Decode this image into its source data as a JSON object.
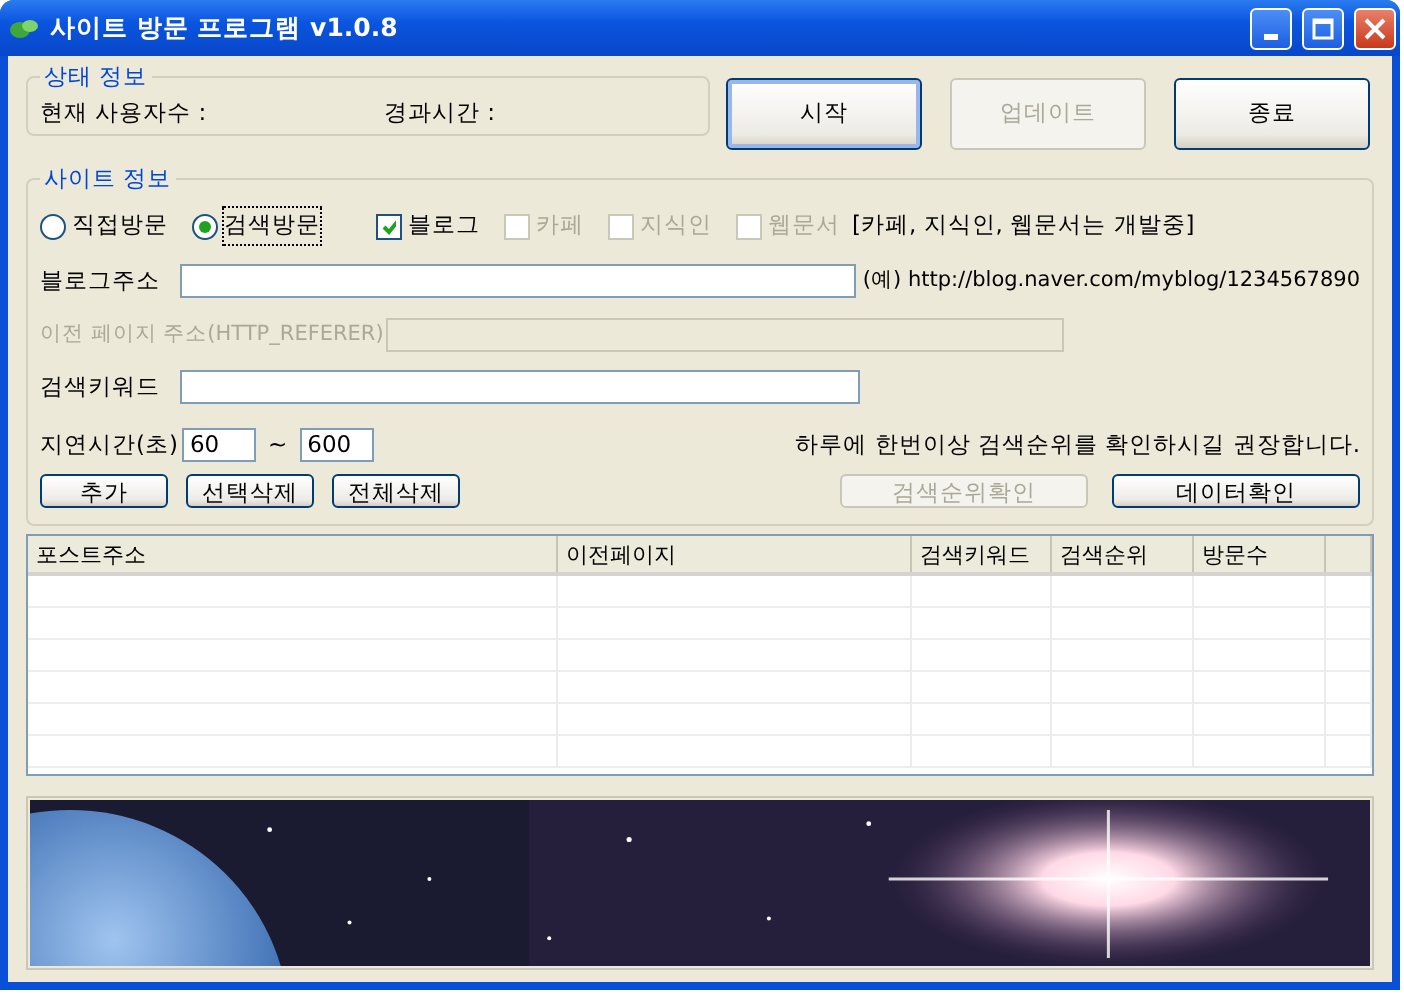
{
  "window": {
    "title": "사이트 방문 프로그램 v1.0.8"
  },
  "status_group": {
    "title": "상태 정보",
    "labels": [
      "현재 사용자수 :",
      "경과시간 :"
    ]
  },
  "top_buttons": [
    {
      "label": "시작",
      "disabled": false,
      "focused": true
    },
    {
      "label": "업데이트",
      "disabled": true,
      "focused": false
    },
    {
      "label": "종료",
      "disabled": false,
      "focused": false
    }
  ],
  "site_group": {
    "title": "사이트 정보",
    "modes": [
      {
        "label": "직접방문",
        "selected": false,
        "focused": false
      },
      {
        "label": "검색방문",
        "selected": true,
        "focused": true
      }
    ],
    "sources": [
      {
        "label": "블로그",
        "checked": true,
        "disabled": false
      },
      {
        "label": "카페",
        "checked": false,
        "disabled": true
      },
      {
        "label": "지식인",
        "checked": false,
        "disabled": true
      },
      {
        "label": "웹문서",
        "checked": false,
        "disabled": true
      }
    ],
    "note": "[카페, 지식인, 웹문서는 개발중]",
    "blog_url": {
      "label": "블로그주소",
      "example": "(예) http://blog.naver.com/myblog/1234567890"
    },
    "referer": {
      "label": "이전 페이지 주소(HTTP_REFERER)",
      "disabled": true
    },
    "keyword": {
      "label": "검색키워드"
    },
    "delay": {
      "label": "지연시간(초)",
      "from": "60",
      "separator": "~",
      "to": "600"
    },
    "advice": "하루에 한번이상 검색순위를 확인하시길 권장합니다.",
    "list_buttons": [
      {
        "label": "추가",
        "disabled": false
      },
      {
        "label": "선택삭제",
        "disabled": false
      },
      {
        "label": "전체삭제",
        "disabled": false
      }
    ],
    "rank_buttons": [
      {
        "label": "검색순위확인",
        "disabled": true
      },
      {
        "label": "데이터확인",
        "disabled": false
      }
    ]
  },
  "table": {
    "columns": [
      "포스트주소",
      "이전페이지",
      "검색키워드",
      "검색순위",
      "방문수"
    ]
  }
}
